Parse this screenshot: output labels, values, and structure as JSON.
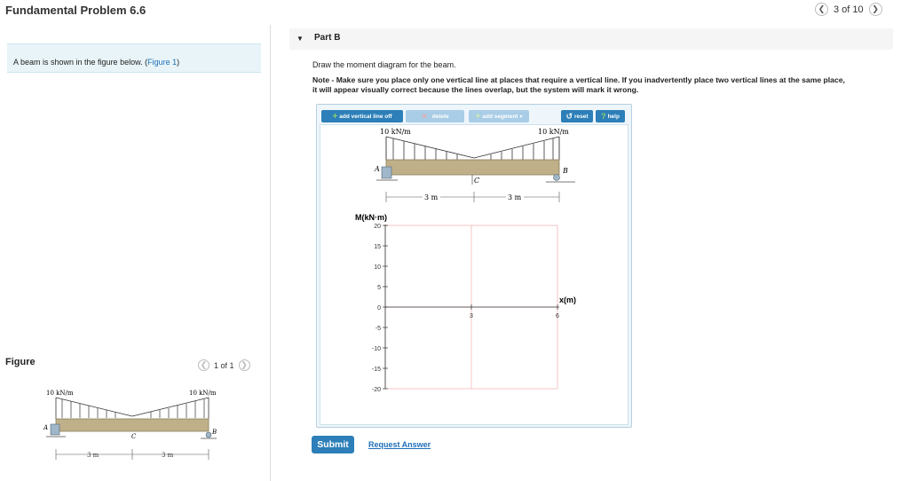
{
  "header": {
    "title": "Fundamental Problem 6.6",
    "pager_text": "3 of 10"
  },
  "left": {
    "intro_text": "A beam is shown in the figure below. (",
    "figure_link": "Figure 1",
    "intro_close": ")",
    "figure_heading": "Figure",
    "figure_pager": "1 of 1"
  },
  "part": {
    "label": "Part B",
    "instruction": "Draw the moment diagram for the beam.",
    "note_line1": "Note - Make sure you place only one vertical line at places that require a vertical line. If you inadvertently place two vertical lines at the same place,",
    "note_line2": "it will appear visually correct because the lines overlap, but the system will mark it wrong."
  },
  "toolbar": {
    "add_vertical": "add vertical line off",
    "delete": "delete",
    "add_segment": "add segment",
    "reset": "reset",
    "help": "help"
  },
  "beam": {
    "load_left": "10 kN/m",
    "load_right": "10 kN/m",
    "support_a": "A",
    "support_b": "B",
    "point_c": "C",
    "dim_left": "3 m",
    "dim_right": "3 m"
  },
  "graph": {
    "y_axis_label": "M(kN·m)",
    "x_axis_label": "x(m)",
    "y_ticks": [
      "20",
      "15",
      "10",
      "5",
      "0",
      "-5",
      "-10",
      "-15",
      "-20"
    ],
    "x_ticks": [
      "3",
      "6"
    ]
  },
  "actions": {
    "submit": "Submit",
    "request_answer": "Request Answer"
  },
  "colors": {
    "accent": "#2c7fb8",
    "panel": "#e8f4f8",
    "grid": "#f2b7b7"
  }
}
